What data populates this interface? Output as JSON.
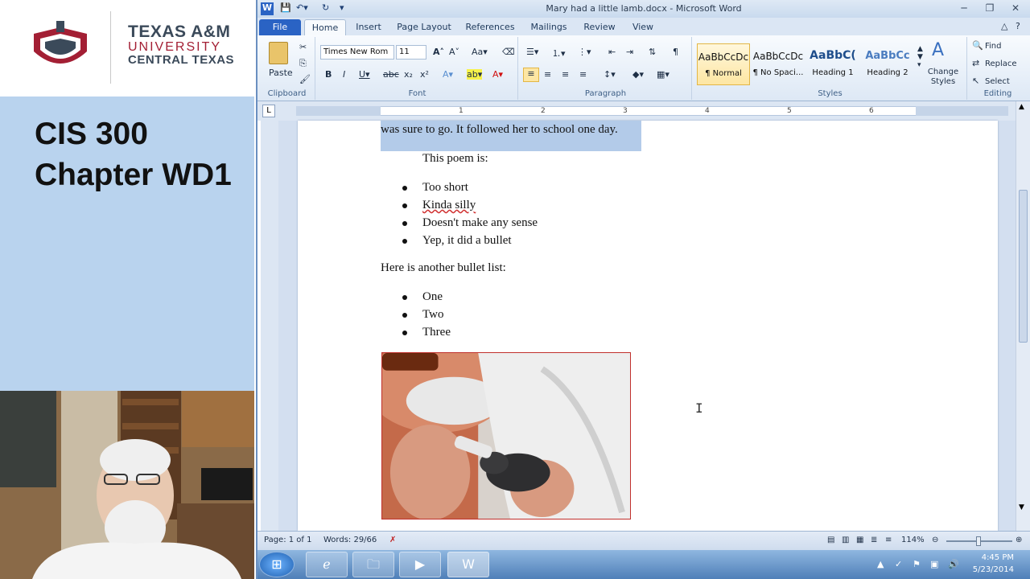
{
  "lecture": {
    "university_l1": "TEXAS A&M",
    "university_l2": "UNIVERSITY",
    "university_l3": "CENTRAL TEXAS",
    "course_line1": "CIS 300",
    "course_line2": "Chapter WD1"
  },
  "window": {
    "title": "Mary had a little lamb.docx - Microsoft Word"
  },
  "tabs": [
    "File",
    "Home",
    "Insert",
    "Page Layout",
    "References",
    "Mailings",
    "Review",
    "View"
  ],
  "ribbon": {
    "clipboard": {
      "paste": "Paste",
      "label": "Clipboard"
    },
    "font": {
      "name": "Times New Rom",
      "size": "11",
      "label": "Font"
    },
    "paragraph": {
      "label": "Paragraph"
    },
    "styles": {
      "label": "Styles",
      "tiles": [
        {
          "sample": "AaBbCcDc",
          "name": "¶ Normal"
        },
        {
          "sample": "AaBbCcDc",
          "name": "¶ No Spaci..."
        },
        {
          "sample": "AaBbC(",
          "name": "Heading 1"
        },
        {
          "sample": "AaBbCc",
          "name": "Heading 2"
        }
      ],
      "change_styles": "Change Styles"
    },
    "editing": {
      "label": "Editing",
      "find": "Find",
      "replace": "Replace",
      "select": "Select"
    }
  },
  "document": {
    "selected_line": "was sure to go.  It followed her to school one day.",
    "intro": "This poem is:",
    "bullets_1": [
      "Too short",
      "Kinda silly",
      "Doesn't make any sense",
      "Yep, it did a bullet"
    ],
    "second_intro": "Here is another bullet list:",
    "bullets_2": [
      "One",
      "Two",
      "Three"
    ]
  },
  "status": {
    "page": "Page: 1 of 1",
    "words": "Words: 29/66",
    "zoom": "114%"
  },
  "taskbar": {
    "time": "4:45 PM",
    "date": "5/23/2014"
  },
  "colors": {
    "accent_blue": "#2a63c4",
    "selection": "#b3cbe9",
    "university_red": "#a31f34"
  }
}
